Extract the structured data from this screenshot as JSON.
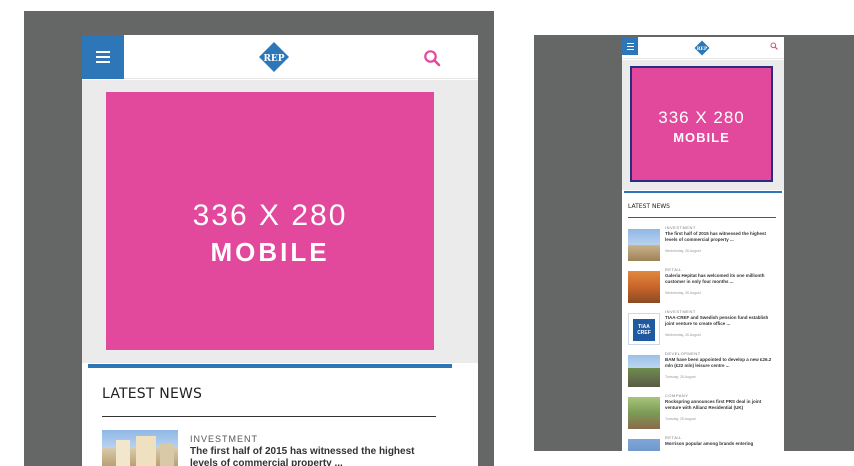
{
  "large": {
    "logo_text": "REP",
    "ad": {
      "size": "336 X 280",
      "kind": "MOBILE"
    },
    "news": {
      "title": "LATEST NEWS",
      "items": [
        {
          "category": "INVESTMENT",
          "headline": "The first half of 2015 has witnessed the highest levels of commercial property ..."
        }
      ]
    }
  },
  "small": {
    "logo_text": "REP",
    "ad": {
      "size": "336 X 280",
      "kind": "MOBILE"
    },
    "news": {
      "title": "LATEST NEWS",
      "items": [
        {
          "category": "INVESTMENT",
          "headline": "The first half of 2015 has witnessed the highest levels of commercial property ...",
          "date": "Wednesday, 26 August",
          "thumb": "city-buildings"
        },
        {
          "category": "RETAIL",
          "headline": "Galeria Hepitat has welcomed its one millionth customer in only four months ...",
          "date": "Wednesday, 26 August",
          "thumb": "shopping-centre"
        },
        {
          "category": "INVESTMENT",
          "headline": "TIAA-CREF and Swedish pension fund establish joint venture to create office ...",
          "date": "Wednesday, 26 August",
          "thumb": "tiaa-cref-logo",
          "thumb_text": "TIAA CREF"
        },
        {
          "category": "DEVELOPMENT",
          "headline": "BAM have been appointed to develop a new £26.2 mln (£22 mln) leisure centre ...",
          "date": "Tuesday, 25 August",
          "thumb": "development-site"
        },
        {
          "category": "COMPANY",
          "headline": "Rockspring announces first PRS deal in joint venture with Allianz Residential (UK)",
          "date": "Tuesday, 25 August",
          "thumb": "residential-building"
        },
        {
          "category": "RETAIL",
          "headline": "Morrison popular among brands entering",
          "date": "",
          "thumb": "retail-street"
        }
      ]
    }
  },
  "colors": {
    "mockup_bg": "#646766",
    "accent_blue": "#2d77b8",
    "ad_pink": "#e2489c",
    "search_pink": "#e2489c"
  },
  "icons": {
    "menu": "hamburger-menu-icon",
    "search": "search-icon",
    "logo": "rep-diamond-logo"
  }
}
